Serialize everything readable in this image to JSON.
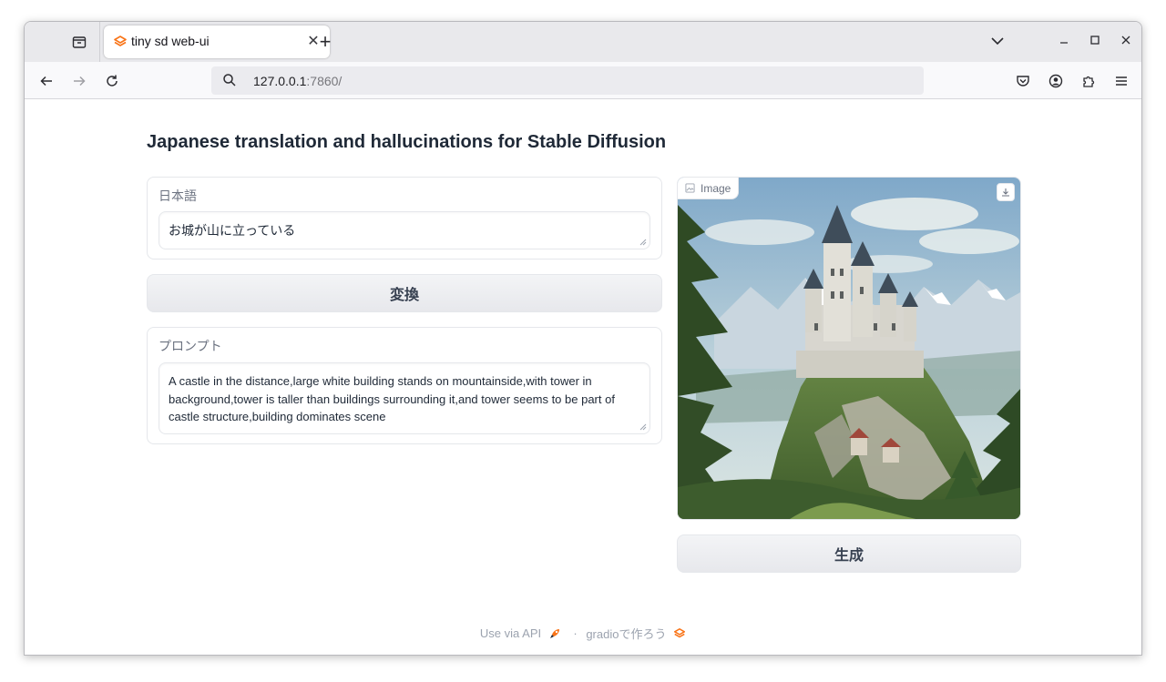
{
  "browser": {
    "tab": {
      "title": "tiny sd web-ui"
    },
    "url": {
      "host": "127.0.0.1",
      "port": ":7860/"
    }
  },
  "app": {
    "title": "Japanese translation and hallucinations for Stable Diffusion",
    "japanese_input": {
      "label": "日本語",
      "value": "お城が山に立っている"
    },
    "convert_button": "変換",
    "prompt_output": {
      "label": "プロンプト",
      "value": "A castle in the distance,large white building stands on mountainside,with tower in background,tower is taller than buildings surrounding it,and tower seems to be part of castle structure,building dominates scene"
    },
    "image_panel": {
      "label": "Image"
    },
    "generate_button": "生成"
  },
  "footer": {
    "api_link": "Use via API",
    "separator": "·",
    "built_with": "gradioで作ろう"
  },
  "colors": {
    "accent_orange": "#f97316",
    "text_primary": "#1f2937",
    "text_muted": "#6b7280"
  }
}
